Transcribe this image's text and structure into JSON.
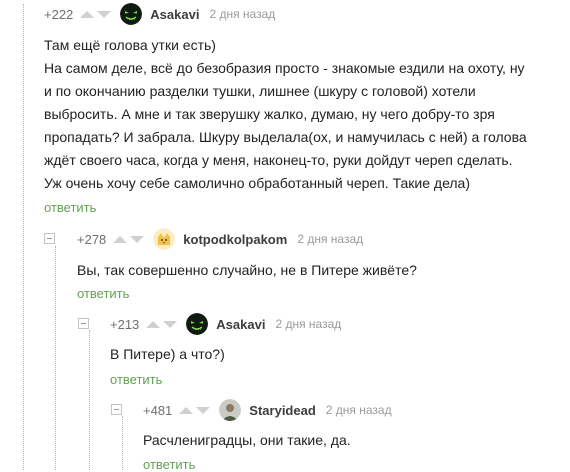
{
  "comments": [
    {
      "rating": "+222",
      "author": "Asakavi",
      "time": "2 дня назад",
      "lines": [
        "Там ещё голова утки есть)",
        "На самом деле, всё до безобразия просто - знакомые ездили на охоту, ну",
        "и по окончанию разделки тушки, лишнее (шкуру с головой) хотели",
        "выбросить. А мне и так зверушку жалко, думаю, ну чего добру-то зря",
        "пропадать? И забрала. Шкуру выделала(ох, и намучилась с ней) а голова",
        "ждёт своего часа, когда у меня, наконец-то, руки дойдут череп сделать.",
        "Уж очень хочу себе самолично обработанный череп. Такие дела)"
      ],
      "reply_label": "ответить"
    },
    {
      "rating": "+278",
      "author": "kotpodkolpakom",
      "time": "2 дня назад",
      "lines": [
        "Вы, так совершенно случайно, не в Питере живёте?"
      ],
      "reply_label": "ответить"
    },
    {
      "rating": "+213",
      "author": "Asakavi",
      "time": "2 дня назад",
      "lines": [
        "В Питере) а что?)"
      ],
      "reply_label": "ответить"
    },
    {
      "rating": "+481",
      "author": "Staryidead",
      "time": "2 дня назад",
      "lines": [
        "Расчлениградцы, они такие, да."
      ],
      "reply_label": "ответить"
    }
  ],
  "icons": {
    "upvote": "arrow-up-icon",
    "downvote": "arrow-down-icon",
    "collapse": "collapse-icon"
  },
  "colors": {
    "reply_link": "#64a055",
    "meta_text": "#9a9a9a",
    "vote_arrow": "#d0d0d0"
  }
}
